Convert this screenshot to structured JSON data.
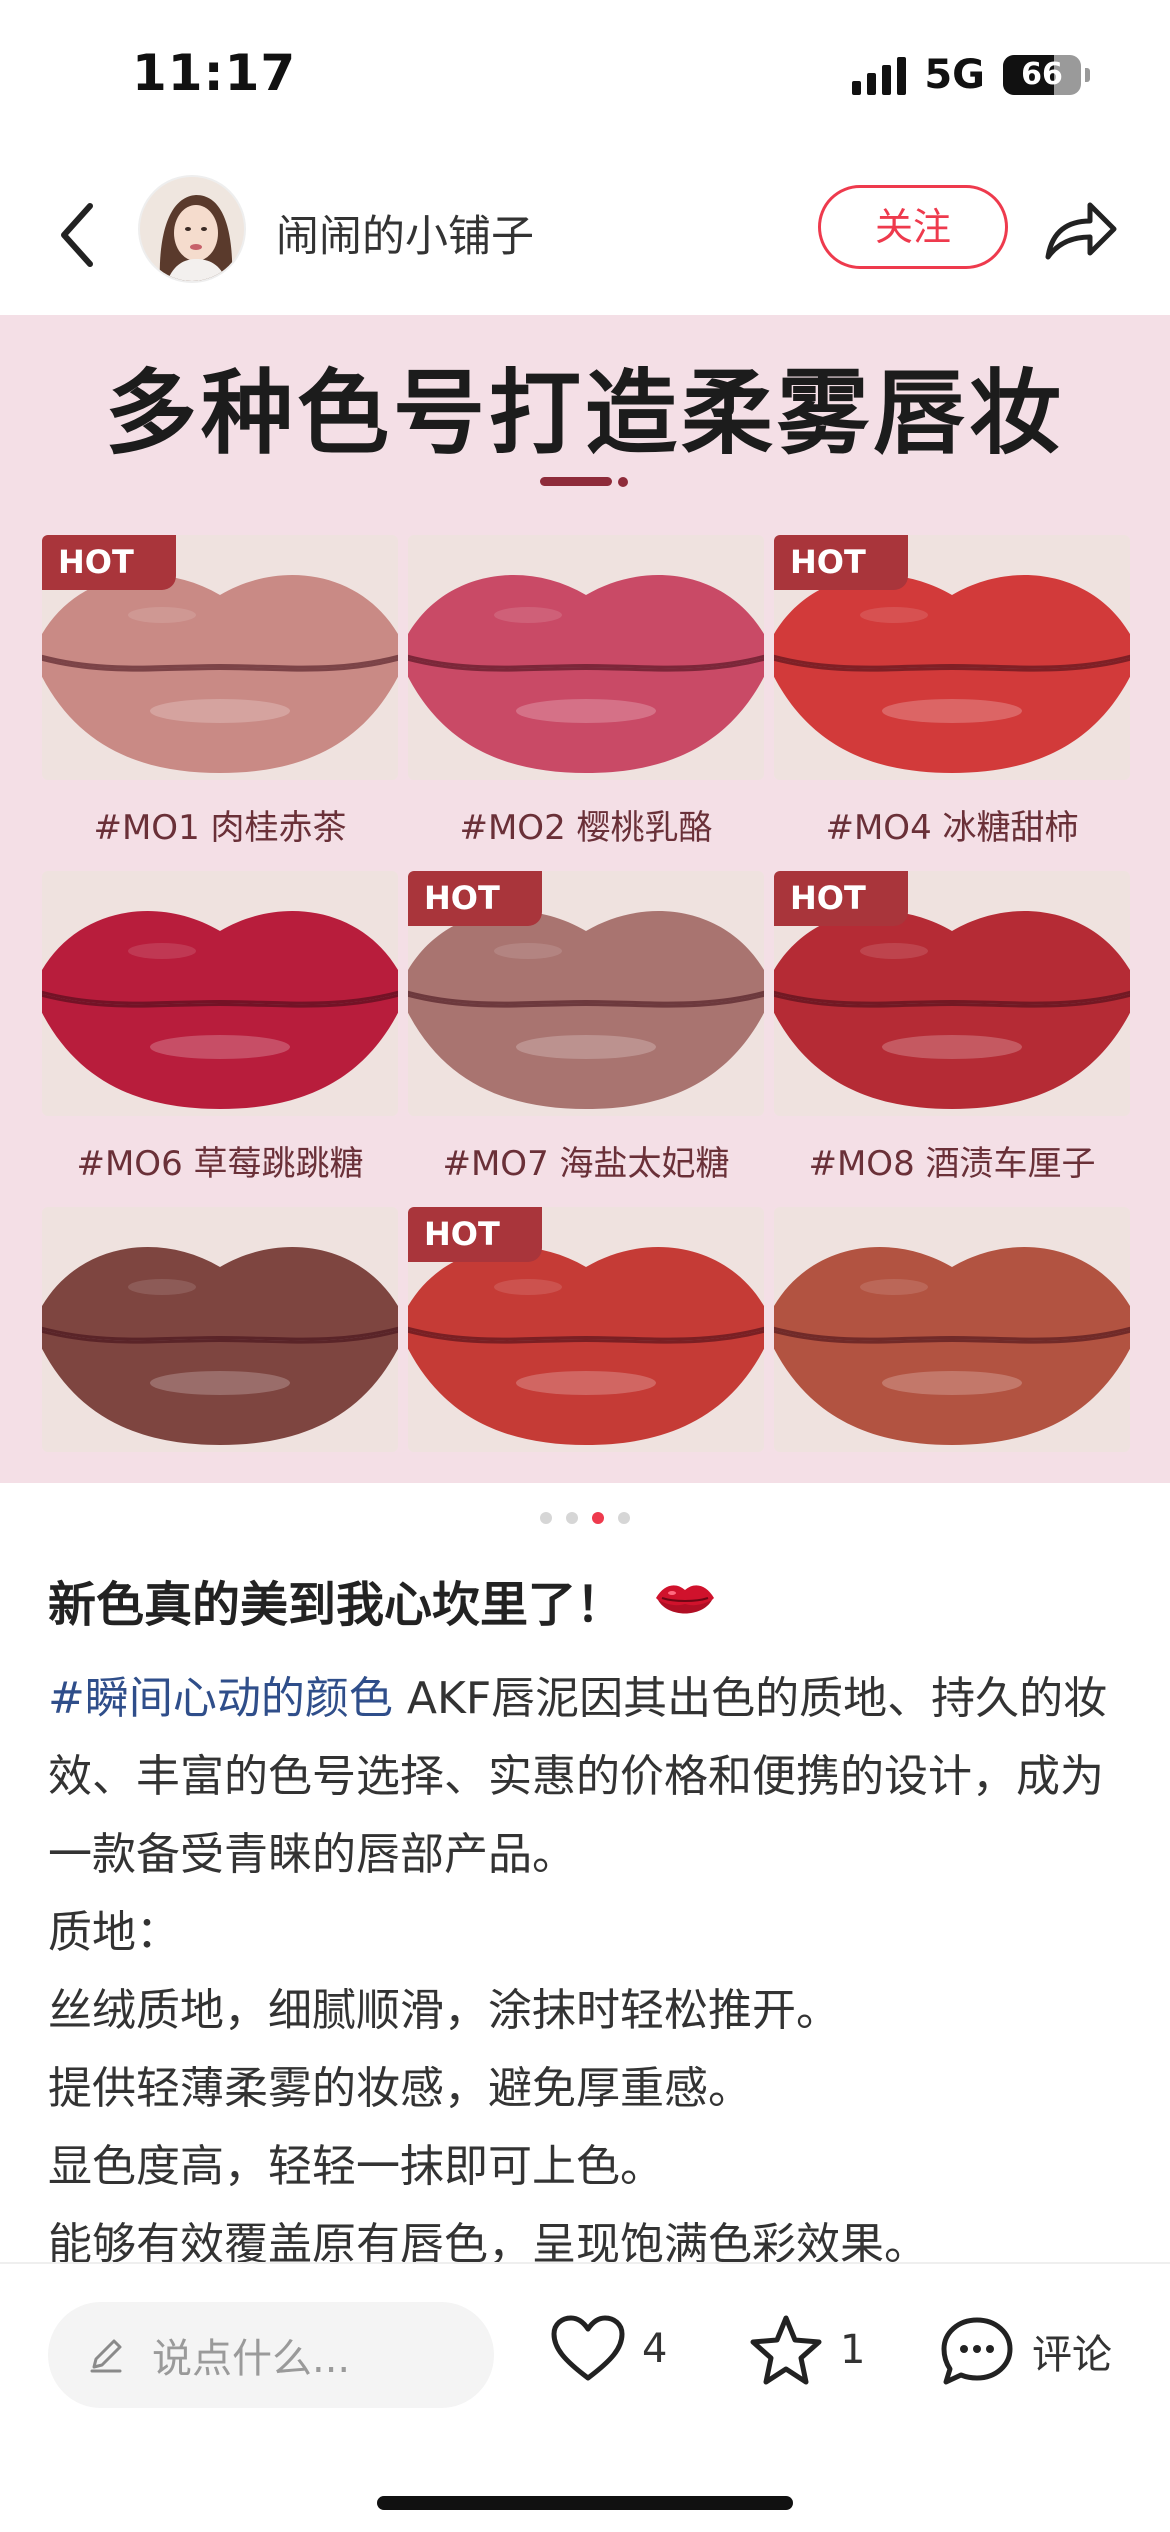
{
  "status_bar": {
    "time": "11:17",
    "network": "5G",
    "battery": "66",
    "battery_level": 0.66
  },
  "header": {
    "back_icon": "chevron-left-icon",
    "shop_name": "闹闹的小铺子",
    "follow_label": "关注",
    "share_icon": "share-arrow-icon"
  },
  "promo_image": {
    "title": "多种色号打造柔雾唇妆",
    "hot_label": "HOT",
    "swatches": [
      {
        "label": "#MO1 肉桂赤茶",
        "hot": true,
        "color": "#c98a85"
      },
      {
        "label": "#MO2 樱桃乳酪",
        "hot": false,
        "color": "#c94a66"
      },
      {
        "label": "#MO4 冰糖甜柿",
        "hot": true,
        "color": "#d23a3a"
      },
      {
        "label": "#MO6 草莓跳跳糖",
        "hot": false,
        "color": "#b81d3c"
      },
      {
        "label": "#MO7 海盐太妃糖",
        "hot": true,
        "color": "#a97470"
      },
      {
        "label": "#MO8 酒渍车厘子",
        "hot": true,
        "color": "#b52b35"
      },
      {
        "label": "",
        "hot": false,
        "color": "#7e4540"
      },
      {
        "label": "",
        "hot": true,
        "color": "#c53b36"
      },
      {
        "label": "",
        "hot": false,
        "color": "#b25341"
      }
    ],
    "page_count": 4,
    "active_page": 3
  },
  "post": {
    "title": "新色真的美到我心坎里了！",
    "emoji_icon": "lips-kiss-icon",
    "hashtag": "#瞬间心动的颜色",
    "intro": " AKF唇泥因其出色的质地、持久的妆效、丰富的色号选择、实惠的价格和便携的设计，成为一款备受青睐的唇部产品。",
    "lines": [
      "质地：",
      "丝绒质地，细腻顺滑，涂抹时轻松推开。",
      "提供轻薄柔雾的妆感，避免厚重感。",
      "显色度高，轻轻一抹即可上色。",
      "能够有效覆盖原有唇色，呈现饱满色彩效果。"
    ]
  },
  "bottom_bar": {
    "comment_placeholder": "说点什么...",
    "likes": "4",
    "favorites": "1",
    "comment_label": "评论",
    "accent_color": "#ee3a4d"
  }
}
